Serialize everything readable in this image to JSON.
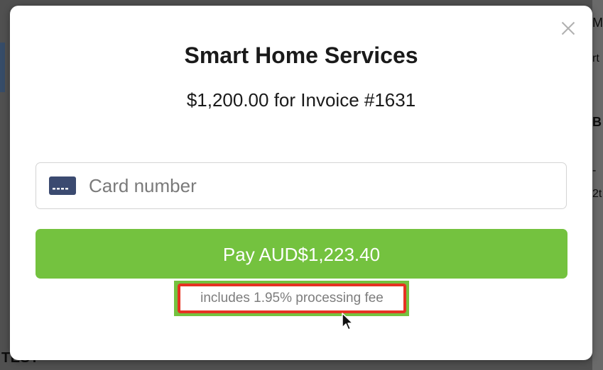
{
  "modal": {
    "title": "Smart Home Services",
    "subtitle": "$1,200.00 for Invoice #1631",
    "close_icon": "close-icon"
  },
  "payment": {
    "card_placeholder": "Card number",
    "card_value": "",
    "card_icon": "credit-card-icon",
    "pay_label": "Pay AUD$1,223.40",
    "fee_note": "includes 1.95% processing fee"
  },
  "background_page": {
    "fragments": [
      "M",
      "rt",
      "B",
      "-",
      "2t"
    ],
    "bottom_text": "TEST"
  },
  "colors": {
    "pay_button": "#74c23f",
    "annotation_box": "#e63222",
    "card_icon": "#3b4a70"
  }
}
